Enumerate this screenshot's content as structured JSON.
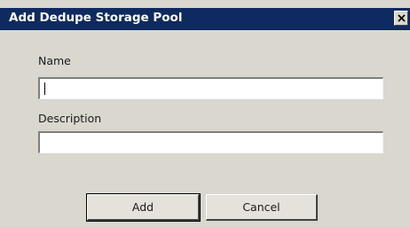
{
  "dialog": {
    "title": "Add Dedupe Storage Pool",
    "close_glyph": "×",
    "close_icon": "close-icon"
  },
  "form": {
    "name_label": "Name",
    "name_value": "",
    "description_label": "Description",
    "description_value": ""
  },
  "buttons": {
    "add_label": "Add",
    "cancel_label": "Cancel"
  },
  "colors": {
    "titlebar": "#0f2a5e",
    "dialog_bg": "#d9d7ce",
    "field_bg": "#ffffff"
  }
}
